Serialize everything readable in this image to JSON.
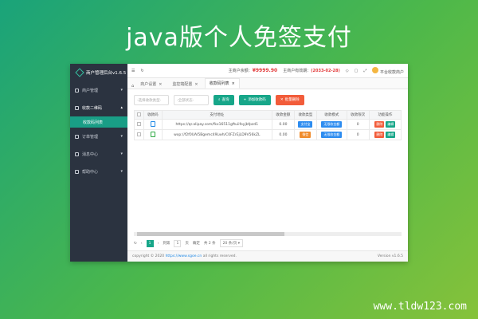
{
  "banner": {
    "title": "java版个人免签支付",
    "watermark": "www.tldw123.com"
  },
  "sidebar": {
    "brand": "商户管理后台v1.6.5",
    "items": [
      {
        "label": "商户管理",
        "icon": "user-icon"
      },
      {
        "label": "收款二维码",
        "icon": "qrcode-icon",
        "open": true,
        "sub": "收款码列表"
      },
      {
        "label": "订单管理",
        "icon": "order-icon"
      },
      {
        "label": "消息中心",
        "icon": "message-icon"
      },
      {
        "label": "帮助中心",
        "icon": "help-icon"
      }
    ]
  },
  "topbar": {
    "balance_label": "主商户余额：",
    "balance_value": "¥9999.90",
    "expire_label": "主商户有效期：",
    "expire_value": "(2033-02-28)",
    "user": "平台收款商户"
  },
  "tabs": [
    {
      "label": "商户设置"
    },
    {
      "label": "监控端配置"
    },
    {
      "label": "收款码列表",
      "active": true
    }
  ],
  "toolbar": {
    "type_placeholder": "-选择收款类型-",
    "status_placeholder": "-全部状态-",
    "search_label": "查询",
    "add_label": "添加收款码",
    "batch_delete_label": "批量删除"
  },
  "table": {
    "headers": [
      "收款码",
      "支付地址",
      "收款金额",
      "收款类型",
      "收款模式",
      "收款限次",
      "功能操作"
    ],
    "rows": [
      {
        "url": "https://qr.alipay.com/fkx16511gftuiifoyjbfpzd1",
        "amount": "0.00",
        "type": "支付宝",
        "type_color": "blue",
        "mode": "无限收金额",
        "limit": "0",
        "delete": "删除",
        "edit": "编辑"
      },
      {
        "url": "wxp://f2f0UAl5Bgemc49Lwh/C0FZrEjLD9V56kZL",
        "amount": "0.00",
        "type": "微信",
        "type_color": "orange",
        "mode": "无限收金额",
        "limit": "0",
        "delete": "删除",
        "edit": "编辑"
      }
    ]
  },
  "pager": {
    "current_page": "1",
    "goto_label": "到第",
    "goto_value": "1",
    "page_unit": "页",
    "confirm": "确定",
    "total": "共 2 条",
    "per_page": "20 条/页"
  },
  "footer": {
    "copyright_prefix": "copyright © 2020",
    "copyright_link": "https://www.sgoe.cn",
    "copyright_suffix": "all rights reserved.",
    "version": "Version v1.6.5"
  },
  "colors": {
    "accent": "#17a689",
    "sidebar_bg": "#2b3340",
    "danger": "#f25c3a"
  }
}
